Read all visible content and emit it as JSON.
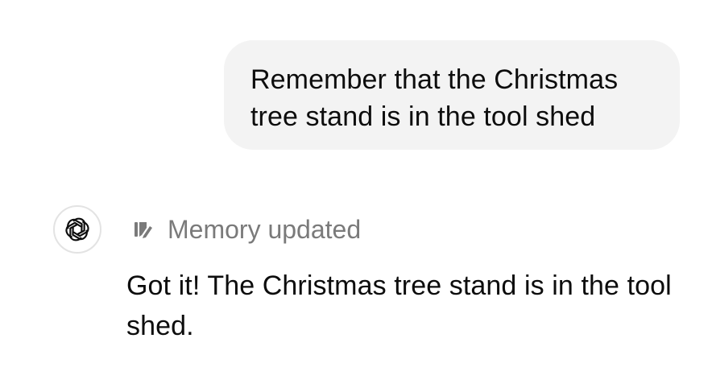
{
  "conversation": {
    "user_message": "Remember that the Christmas tree stand is in the tool shed",
    "assistant": {
      "avatar_icon": "openai-logo-icon",
      "memory_status": {
        "icon": "memory-edit-icon",
        "label": "Memory updated",
        "color": "#7a7a7a"
      },
      "message": "Got it! The Christmas tree stand is in the tool shed."
    }
  },
  "colors": {
    "user_bubble_bg": "#f3f3f3",
    "text": "#0d0d0d",
    "avatar_border": "#e3e3e3"
  }
}
